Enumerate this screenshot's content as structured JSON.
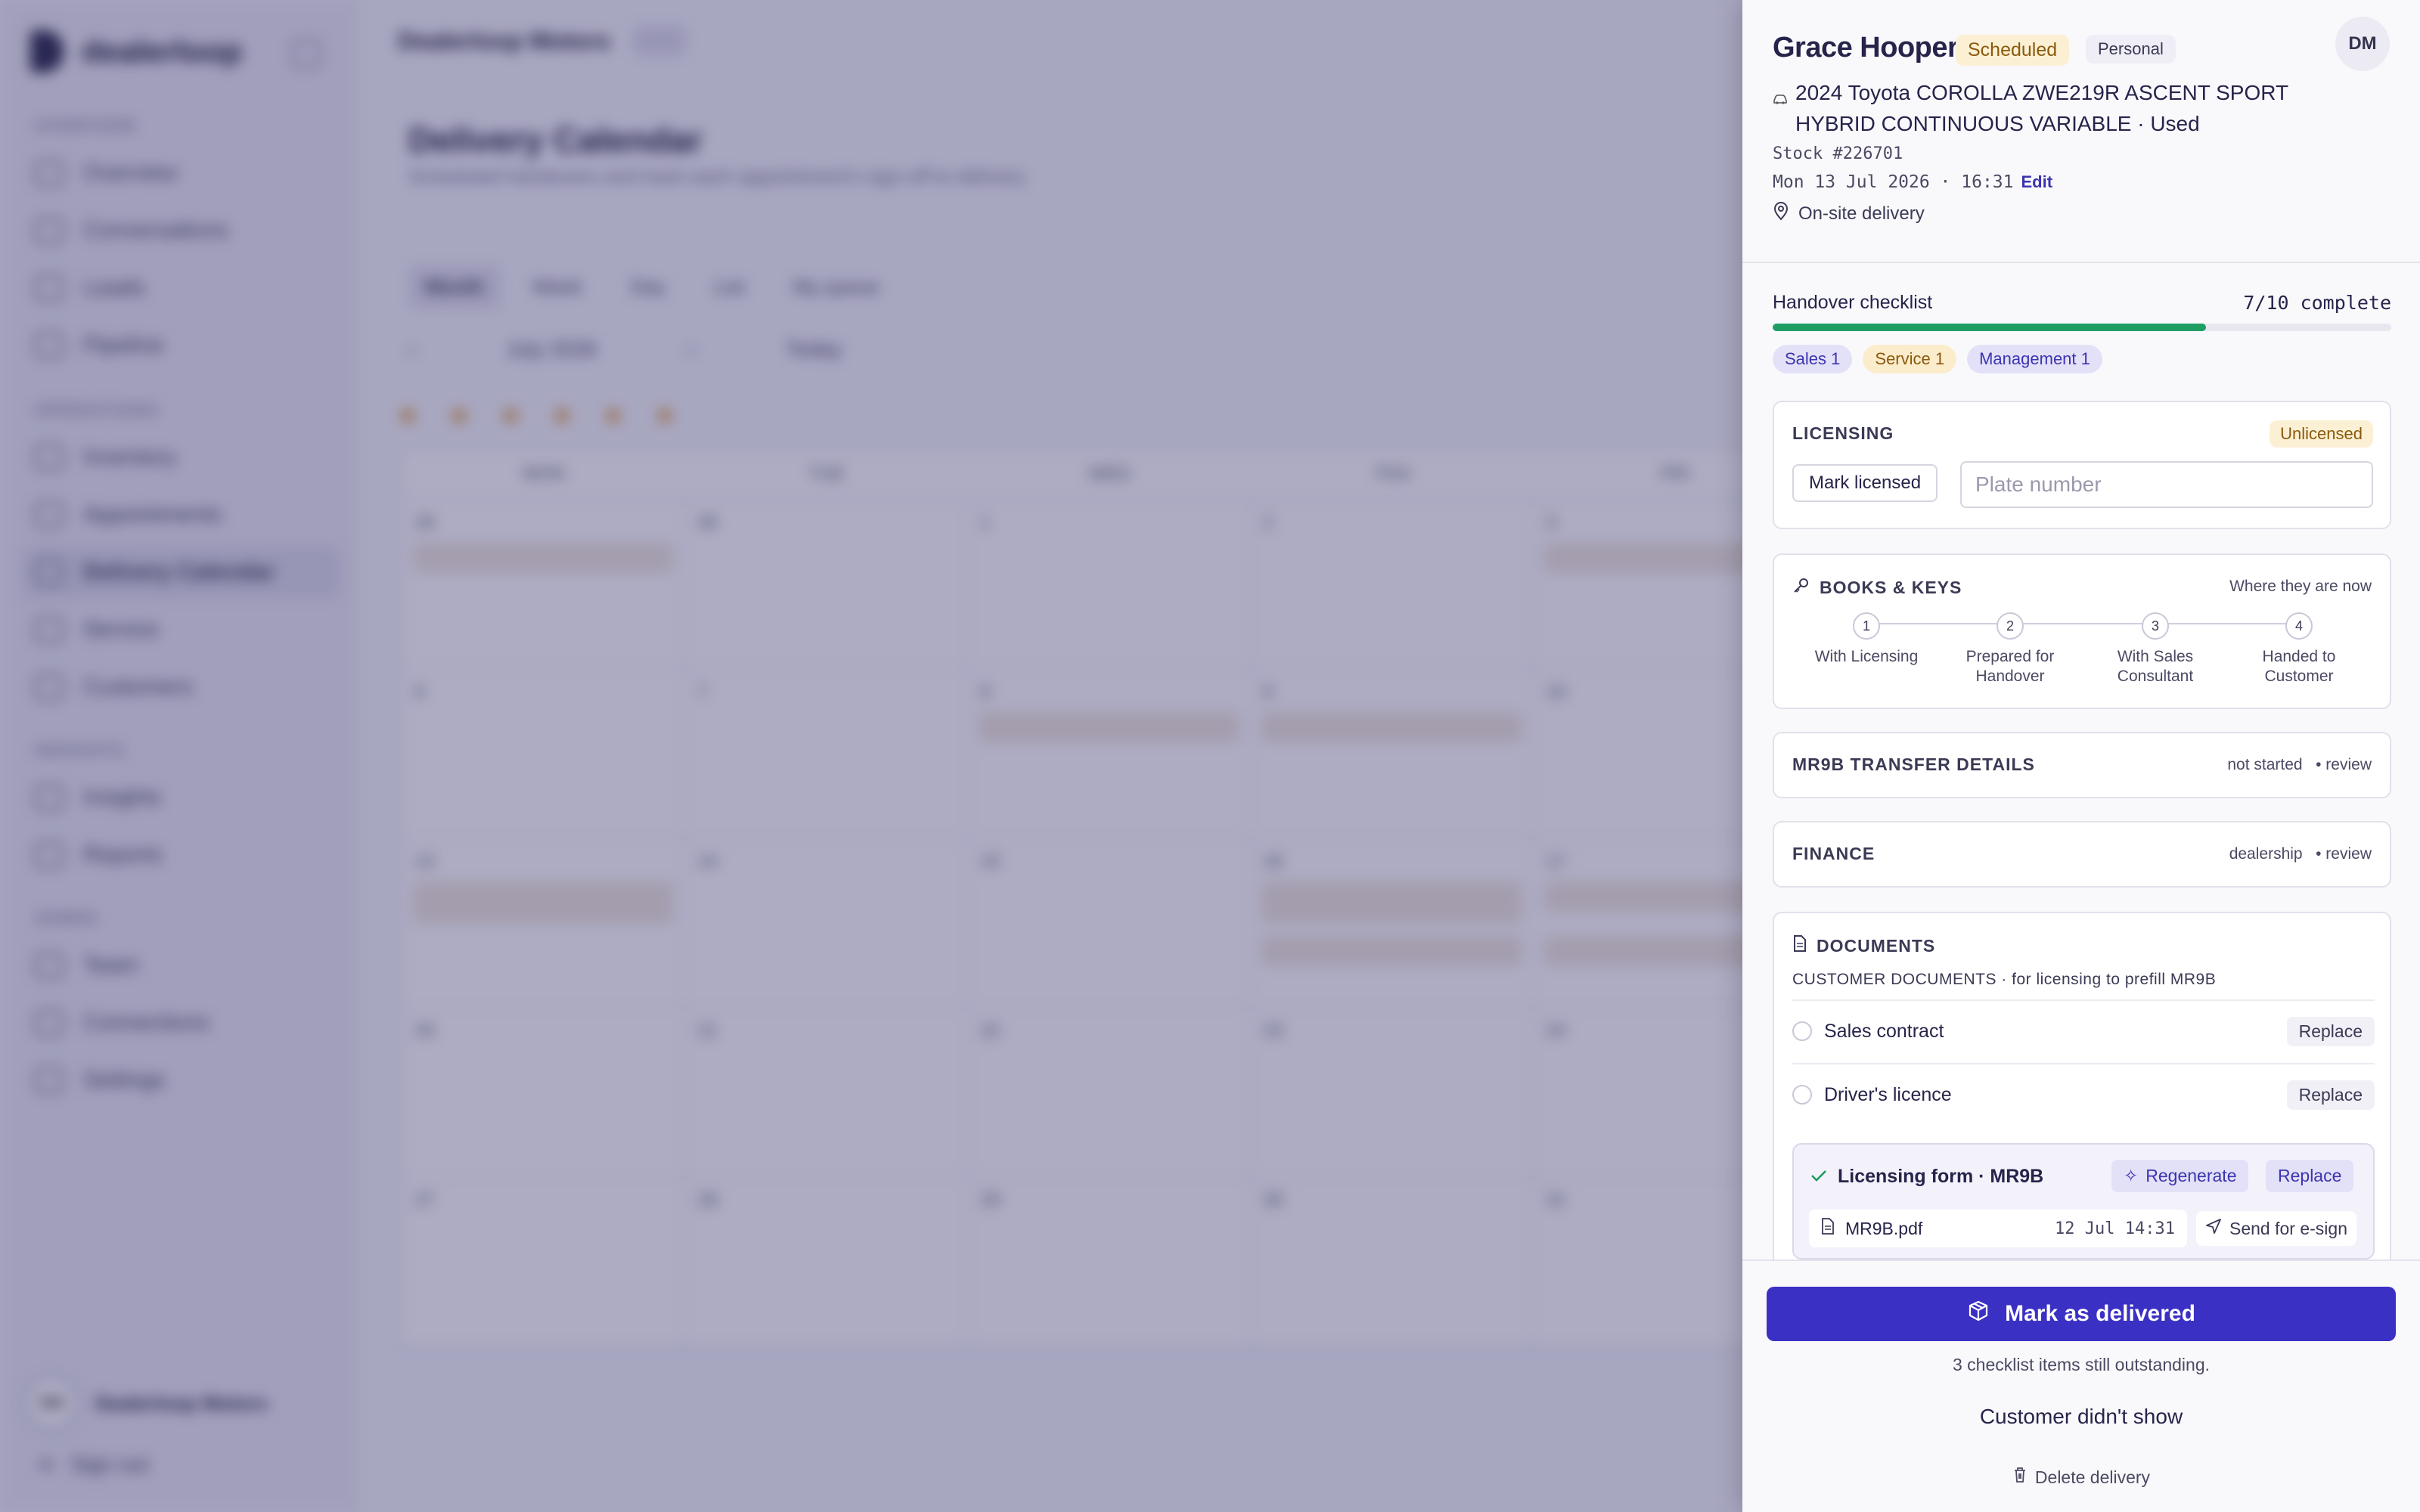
{
  "app": {
    "brand": "dealerloop",
    "org": "Dealerloop Motors",
    "page_title": "Delivery Calendar",
    "page_subtitle": "Scheduled handovers and track each appointment's sign-off to delivery",
    "nav_sections": [
      "OVERVIEW",
      "OPERATIONS",
      "INSIGHTS",
      "ADMIN"
    ],
    "nav_items": [
      "Overview",
      "Conversations",
      "Leads",
      "Pipeline",
      "Inventory",
      "Appointments",
      "Delivery Calendar",
      "Service",
      "Customers",
      "Insights",
      "Reports",
      "Team",
      "Connections",
      "Settings"
    ],
    "user_name": "Dealerloop Motors",
    "user_initials": "DM",
    "sign_out": "Sign out",
    "view_tabs": [
      "Month",
      "Week",
      "Day",
      "List",
      "My queue"
    ],
    "month_label": "July 2026",
    "today": "Today",
    "weekdays": [
      "MON",
      "TUE",
      "WED",
      "THU",
      "FRI"
    ],
    "calendar_days": [
      "29",
      "30",
      "1",
      "2",
      "3",
      "6",
      "7",
      "8",
      "9",
      "10",
      "13",
      "14",
      "15",
      "16",
      "17",
      "20",
      "21",
      "22",
      "23",
      "24",
      "27",
      "28",
      "29",
      "30",
      "31"
    ]
  },
  "drawer": {
    "customer_name": "Grace Hooper",
    "status_badge": "Scheduled",
    "type_badge": "Personal",
    "owner_initials": "DM",
    "vehicle": "2024 Toyota COROLLA ZWE219R ASCENT SPORT HYBRID CONTINUOUS VARIABLE · Used",
    "stock": "Stock #226701",
    "datetime": "Mon 13 Jul 2026 · 16:31",
    "edit_label": "Edit",
    "location": "On-site delivery",
    "checklist": {
      "label": "Handover checklist",
      "count": "7/10 complete",
      "progress": 0.7,
      "chips": [
        "Sales 1",
        "Service 1",
        "Management 1"
      ]
    },
    "licensing": {
      "title": "LICENSING",
      "badge": "Unlicensed",
      "button": "Mark licensed",
      "plate_placeholder": "Plate number"
    },
    "books_keys": {
      "title": "BOOKS & KEYS",
      "right": "Where they are now",
      "steps": [
        {
          "num": "1",
          "label": "With Licensing"
        },
        {
          "num": "2",
          "label": "Prepared for Handover"
        },
        {
          "num": "3",
          "label": "With Sales Consultant"
        },
        {
          "num": "4",
          "label": "Handed to Customer"
        }
      ]
    },
    "mr9b": {
      "title": "MR9B TRANSFER DETAILS",
      "status": "not started",
      "action": "• review"
    },
    "finance": {
      "title": "FINANCE",
      "status": "dealership",
      "action": "• review"
    },
    "documents": {
      "title": "DOCUMENTS",
      "subtitle": "CUSTOMER DOCUMENTS · for licensing to prefill MR9B",
      "rows": [
        {
          "name": "Sales contract",
          "action": "Replace"
        },
        {
          "name": "Driver's licence",
          "action": "Replace"
        }
      ],
      "form": {
        "title": "Licensing form · MR9B",
        "regenerate": "Regenerate",
        "replace": "Replace",
        "file": "MR9B.pdf",
        "file_time": "12 Jul 14:31",
        "esign": "Send for e-sign"
      }
    },
    "footer": {
      "deliver": "Mark as delivered",
      "outstanding": "3 checklist items still outstanding.",
      "no_show": "Customer didn't show",
      "delete": "Delete delivery"
    }
  }
}
